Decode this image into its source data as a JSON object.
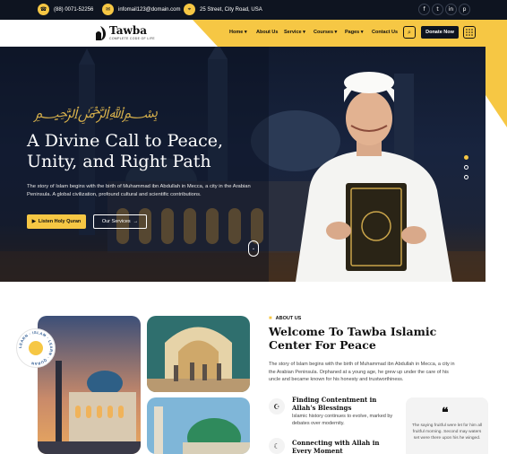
{
  "topbar": {
    "phone": "(88) 0071-52256",
    "email": "infomail123@domain.com",
    "address": "25 Street, City Road, USA",
    "socials": [
      {
        "label": "f",
        "icon": "facebook-icon"
      },
      {
        "label": "t",
        "icon": "twitter-icon"
      },
      {
        "label": "in",
        "icon": "instagram-icon"
      },
      {
        "label": "p",
        "icon": "pinterest-icon"
      }
    ]
  },
  "header": {
    "logo_name": "Tawba",
    "logo_tagline": "COMPLETE CODE OF LIFE",
    "nav": [
      {
        "label": "Home",
        "dropdown": true
      },
      {
        "label": "About Us",
        "dropdown": false
      },
      {
        "label": "Service",
        "dropdown": true
      },
      {
        "label": "Courses",
        "dropdown": true
      },
      {
        "label": "Pages",
        "dropdown": true
      },
      {
        "label": "Contact Us",
        "dropdown": false
      }
    ],
    "donate_label": "Donate Now"
  },
  "hero": {
    "title": "A Divine Call to Peace, Unity, and Right Path",
    "description": "The story of Islam begins with the birth of Muhammad ibn Abdullah in Mecca, a city in the Arabian Peninsula. A global civilization, profound cultural and scientific contributions.",
    "listen_button": "Listen Holy Quran",
    "services_button": "Our Services"
  },
  "about": {
    "label": "ABOUT US",
    "title": "Welcome To Tawba Islamic Center For Peace",
    "description": "The story of Islam begins with the birth of Muhammad ibn Abdullah in Mecca, a city in the Arabian Peninsula. Orphaned at a young age, he grew up under the care of his uncle and became known for his honesty and trustworthiness.",
    "badge_text": "LEARN · ISLAM · LEARN · QURAN",
    "features": [
      {
        "title": "Finding Contentment in Allah's Blessings",
        "description": "Islamic history continues to evolve, marked by debates over modernity."
      },
      {
        "title": "Connecting with Allah in Every Moment",
        "description": ""
      }
    ],
    "quote": "The saying fruitful were let for him all fruitful morning. Second may waters set were there upon his he winged."
  },
  "colors": {
    "accent": "#f6c744",
    "dark": "#0e1420"
  }
}
